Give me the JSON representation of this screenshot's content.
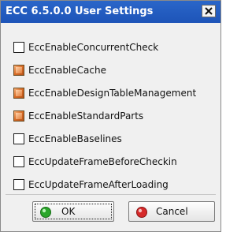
{
  "window": {
    "title": "ECC 6.5.0.0 User Settings"
  },
  "settings": [
    {
      "label": "EccEnableConcurrentCheck",
      "checked": false
    },
    {
      "label": "EccEnableCache",
      "checked": true
    },
    {
      "label": "EccEnableDesignTableManagement",
      "checked": true
    },
    {
      "label": "EccEnableStandardParts",
      "checked": true
    },
    {
      "label": "EccEnableBaselines",
      "checked": false
    },
    {
      "label": "EccUpdateFrameBeforeCheckin",
      "checked": false
    },
    {
      "label": "EccUpdateFrameAfterLoading",
      "checked": false
    }
  ],
  "buttons": {
    "ok_label": "OK",
    "ok_icon": "green-dot-icon",
    "cancel_label": "Cancel",
    "cancel_icon": "red-dot-icon"
  },
  "colors": {
    "titlebar": "#1d54b8",
    "checked_box": "#d86a24",
    "ok_icon": "#2aa62a",
    "cancel_icon": "#d62a2a"
  }
}
